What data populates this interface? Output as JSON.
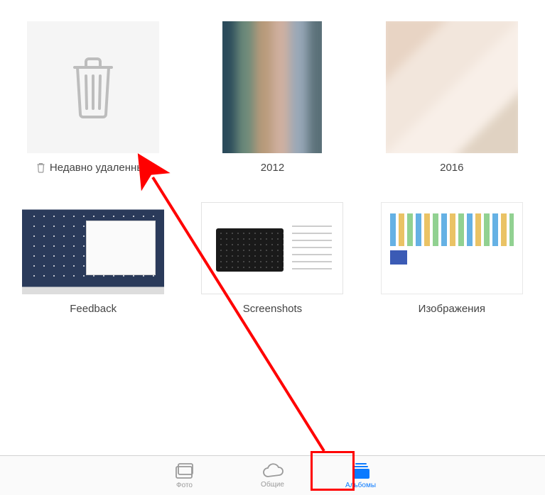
{
  "albums": [
    {
      "id": "recently-deleted",
      "label": "Недавно удаленные",
      "has_trash_icon": true
    },
    {
      "id": "2012",
      "label": "2012"
    },
    {
      "id": "2016",
      "label": "2016"
    },
    {
      "id": "feedback",
      "label": "Feedback"
    },
    {
      "id": "screenshots",
      "label": "Screenshots"
    },
    {
      "id": "izobrazheniya",
      "label": "Изображения"
    }
  ],
  "tabs": {
    "photos": "Фото",
    "shared": "Общие",
    "albums": "Альбомы"
  },
  "colors": {
    "active": "#0a7aff",
    "inactive": "#9a9a9a",
    "annotation": "#ff0000"
  }
}
